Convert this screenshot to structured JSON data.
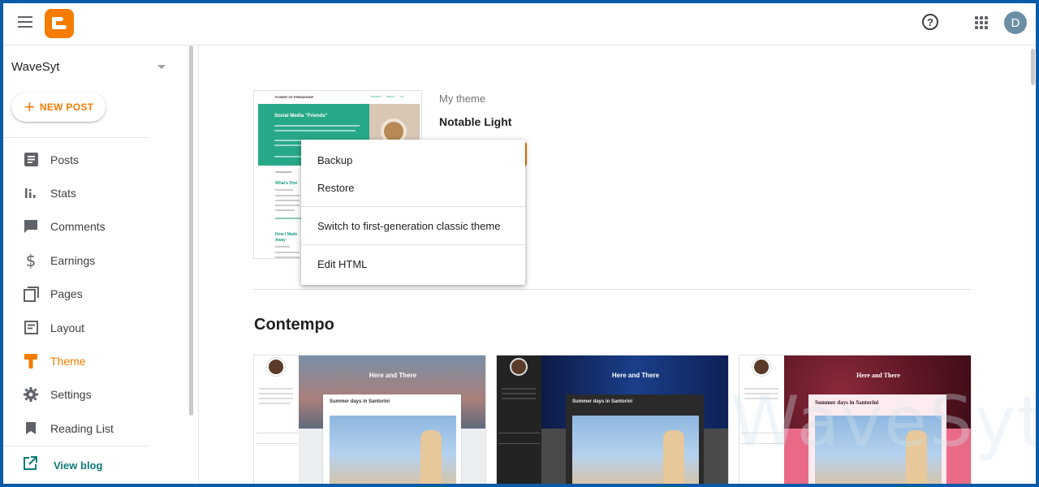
{
  "app": {
    "brand_color": "#f57c00",
    "avatar_letter": "D",
    "help_glyph": "?"
  },
  "sidebar": {
    "blog_name": "WaveSyt",
    "new_post_label": "NEW POST",
    "items": [
      {
        "label": "Posts",
        "icon": "posts-icon",
        "active": false
      },
      {
        "label": "Stats",
        "icon": "stats-icon",
        "active": false
      },
      {
        "label": "Comments",
        "icon": "comments-icon",
        "active": false
      },
      {
        "label": "Earnings",
        "icon": "dollar-icon",
        "active": false
      },
      {
        "label": "Pages",
        "icon": "pages-icon",
        "active": false
      },
      {
        "label": "Layout",
        "icon": "layout-icon",
        "active": false
      },
      {
        "label": "Theme",
        "icon": "theme-icon",
        "active": true
      },
      {
        "label": "Settings",
        "icon": "gear-icon",
        "active": false
      },
      {
        "label": "Reading List",
        "icon": "bookmark-icon",
        "active": false
      }
    ],
    "view_blog_label": "View blog"
  },
  "my_theme": {
    "label": "My theme",
    "name": "Notable Light",
    "thumb": {
      "blog_title": "POWER OF FRIENDSHIP",
      "nav": [
        "CONTACT",
        "ABOUT",
        "US"
      ],
      "hero_title": "Social Media \"Friends\"",
      "post2_title": "What's Dist",
      "post3_title": "How I Made Away"
    }
  },
  "menu": {
    "items": [
      {
        "label": "Backup"
      },
      {
        "label": "Restore"
      },
      {
        "label": "Switch to first-generation classic theme"
      },
      {
        "label": "Edit HTML"
      }
    ]
  },
  "gallery": {
    "section_title": "Contempo",
    "cards": [
      {
        "header": "Here and There",
        "post_title": "Summer days in Santorini",
        "variant": "light"
      },
      {
        "header": "Here and There",
        "post_title": "Summer days in Santorini",
        "variant": "dark"
      },
      {
        "header": "Here and There",
        "post_title": "Summer days in Santorini",
        "variant": "rose"
      }
    ]
  },
  "watermark": "WaveSyt"
}
